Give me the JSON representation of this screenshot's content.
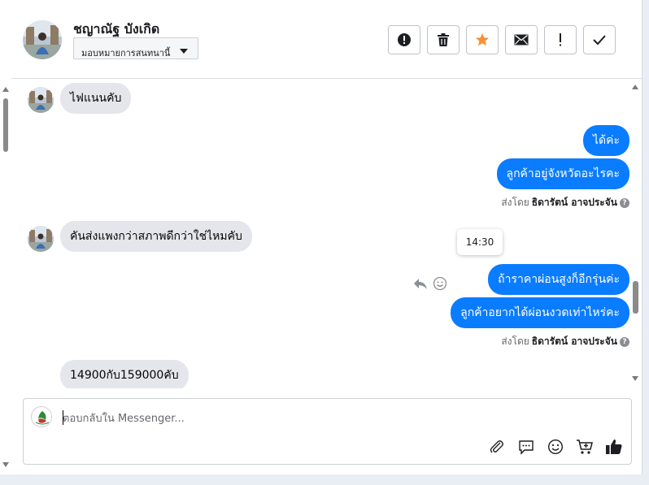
{
  "header": {
    "contact_name": "ชญาณัฐ บังเกิด",
    "assign_label": "มอบหมายการสนทนานี้",
    "toolbar_icons": [
      "alert-circle-icon",
      "trash-icon",
      "star-icon",
      "envelope-icon",
      "exclamation-icon",
      "check-icon"
    ]
  },
  "colors": {
    "outgoing_bubble": "#0a7cff",
    "incoming_bubble": "#e4e6eb",
    "star": "#f7923a"
  },
  "messages": [
    {
      "direction": "in",
      "text": "ไฟแนนคับ"
    },
    {
      "direction": "out",
      "text": "ได้ค่ะ"
    },
    {
      "direction": "out",
      "text": "ลูกค้าอยู่จังหวัดอะไรคะ"
    },
    {
      "direction": "in",
      "text": "คันส่งแพงกว่าสภาพดีกว่าใช่ไหมคับ"
    },
    {
      "direction": "out",
      "text": "ถ้าราคาผ่อนสูงก็อีกรุ่นค่ะ"
    },
    {
      "direction": "out",
      "text": "ลูกค้าอยากได้ผ่อนงวดเท่าไหร่คะ"
    },
    {
      "direction": "in",
      "text": "14900กับ159000คับ"
    }
  ],
  "sent_by": {
    "prefix": "ส่งโดย",
    "name": "ธิดารัตน์ อาจประจัน",
    "info_glyph": "?"
  },
  "tooltip_time": "14:30",
  "composer": {
    "placeholder": "ตอบกลับใน Messenger...",
    "tools": [
      "paperclip-icon",
      "chat-bubble-icon",
      "smiley-icon",
      "cart-icon",
      "thumbs-up-icon"
    ]
  }
}
